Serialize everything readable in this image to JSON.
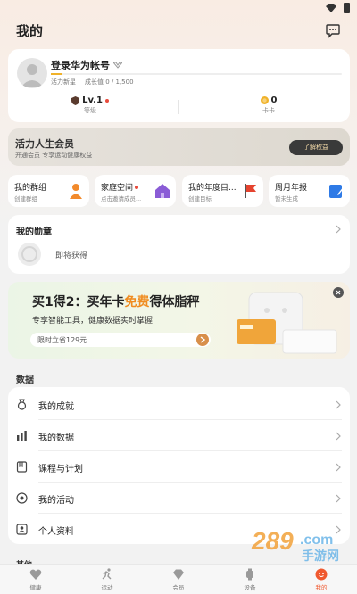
{
  "header": {
    "title": "我的"
  },
  "profile": {
    "login_text": "登录华为帐号",
    "level_name": "活力新星",
    "growth_label": "成长值 0 / 1,500",
    "xp_progress": 0.0,
    "level_value": "Lv.1",
    "level_caption": "等级",
    "coupon_value": "0",
    "coupon_caption": "卡卡"
  },
  "membership": {
    "title": "活力人生会员",
    "subtitle": "开通会员 专享运动健康权益",
    "button": "了解权益"
  },
  "tiles": [
    {
      "title": "我的群组",
      "sub": "创建群组",
      "icon": "people-icon",
      "has_dot": false
    },
    {
      "title": "家庭空间",
      "sub": "点击邀请成员...",
      "icon": "house-icon",
      "has_dot": true
    },
    {
      "title": "我的年度目...",
      "sub": "创建目标",
      "icon": "flag-icon",
      "has_dot": false
    },
    {
      "title": "周月年报",
      "sub": "暂未生成",
      "icon": "report-icon",
      "has_dot": false
    }
  ],
  "medals": {
    "title": "我的勋章",
    "placeholder": "即将获得"
  },
  "promo": {
    "title_prefix": "买1得2：买年卡",
    "title_free": "免费",
    "title_suffix": "得体脂秤",
    "subtitle": "专享智能工具，健康数据实时掌握",
    "cta": "限时立省129元"
  },
  "data_section": {
    "label": "数据",
    "items": [
      {
        "label": "我的成就",
        "icon": "medal-icon"
      },
      {
        "label": "我的数据",
        "icon": "bar-chart-icon"
      },
      {
        "label": "课程与计划",
        "icon": "bookmark-icon"
      },
      {
        "label": "我的活动",
        "icon": "activity-icon"
      },
      {
        "label": "个人资料",
        "icon": "profile-icon"
      }
    ]
  },
  "more_peek": "其他",
  "bottom_nav": [
    {
      "label": "健康",
      "icon": "heart-icon",
      "active": false
    },
    {
      "label": "运动",
      "icon": "run-icon",
      "active": false
    },
    {
      "label": "会员",
      "icon": "diamond-icon",
      "active": false
    },
    {
      "label": "设备",
      "icon": "watch-icon",
      "active": false
    },
    {
      "label": "我的",
      "icon": "me-icon",
      "active": true
    }
  ],
  "colors": {
    "accent": "#f0592f",
    "gold": "#f0b22a",
    "promo_orange": "#f08c20",
    "member_button": "#3a3a3a"
  }
}
